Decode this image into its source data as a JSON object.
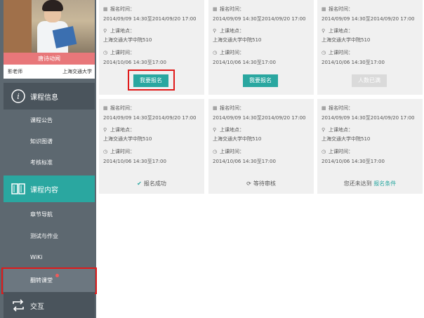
{
  "sidebar": {
    "teacher_display_name": "唐诗动闻",
    "teacher_label": "影老师",
    "teacher_school": "上海交通大学",
    "section_course_info": "课程信息",
    "items_info": [
      "课程公告",
      "知识图谱",
      "考核标准"
    ],
    "section_course_content": "课程内容",
    "items_content": [
      "章节导航",
      "测试与作业",
      "WiKi",
      "翻转课堂"
    ],
    "section_interact": "交互"
  },
  "cards": [
    {
      "reg_label": "报名时间：",
      "reg_time": "2014/09/09 14:30至2014/09/20 17:00",
      "loc_label": "上课地点：",
      "location": "上海交通大学中院510",
      "class_label": "上课时间：",
      "class_time": "2014/10/06 14:30至17:00",
      "action": "我要报名"
    },
    {
      "reg_label": "报名时间：",
      "reg_time": "2014/09/09 14:30至2014/09/20 17:00",
      "loc_label": "上课地点：",
      "location": "上海交通大学中院510",
      "class_label": "上课时间：",
      "class_time": "2014/10/06 14:30至17:00",
      "action": "我要报名"
    },
    {
      "reg_label": "报名时间：",
      "reg_time": "2014/09/09 14:30至2014/09/20 17:00",
      "loc_label": "上课地点：",
      "location": "上海交通大学中院510",
      "class_label": "上课时间：",
      "class_time": "2014/10/06 14:30至17:00",
      "action": "人数已满"
    },
    {
      "reg_label": "报名时间：",
      "reg_time": "2014/09/09 14:30至2014/09/20 17:00",
      "loc_label": "上课地点：",
      "location": "上海交通大学中院510",
      "class_label": "上课时间：",
      "class_time": "2014/10/06 14:30至17:00",
      "status": "报名成功"
    },
    {
      "reg_label": "报名时间：",
      "reg_time": "2014/09/09 14:30至2014/09/20 17:00",
      "loc_label": "上课地点：",
      "location": "上海交通大学中院510",
      "class_label": "上课时间：",
      "class_time": "2014/10/06 14:30至17:00",
      "status": "等待审核"
    },
    {
      "reg_label": "报名时间：",
      "reg_time": "2014/09/09 14:30至2014/09/20 17:00",
      "loc_label": "上课地点：",
      "location": "上海交通大学中院510",
      "class_label": "上课时间：",
      "class_time": "2014/10/06 14:30至17:00",
      "status_prefix": "您还未达到",
      "status_link": "报名条件"
    }
  ],
  "icons": {
    "calendar": "calendar-icon",
    "location": "location-pin-icon",
    "clock": "clock-icon"
  },
  "colors": {
    "accent": "#2aa7a0",
    "highlight": "#e01a1a",
    "name_bar": "#e8777a",
    "sidebar": "#5d6870"
  }
}
